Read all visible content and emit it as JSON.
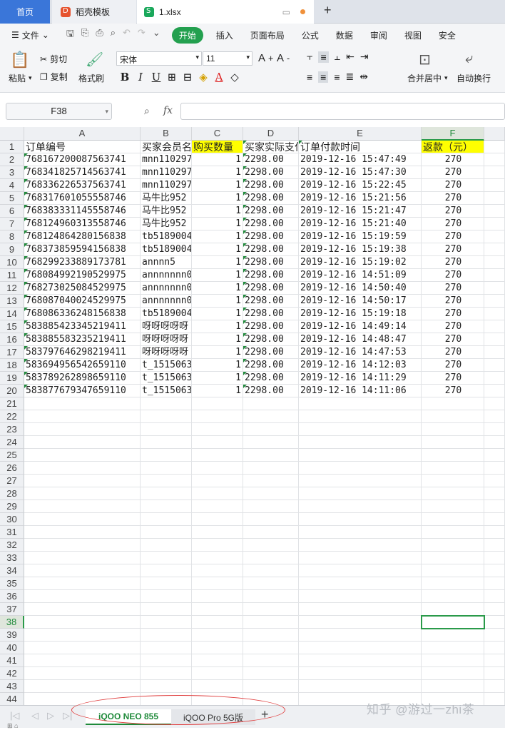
{
  "tabs": {
    "home": "首页",
    "template": "稻壳模板",
    "file": "1.xlsx"
  },
  "menu": {
    "file": "文件",
    "items": [
      "开始",
      "插入",
      "页面布局",
      "公式",
      "数据",
      "审阅",
      "视图",
      "安全"
    ]
  },
  "ribbon": {
    "paste": "粘贴",
    "cut": "剪切",
    "copy": "复制",
    "format_painter": "格式刷",
    "font_name": "宋体",
    "font_size": "11",
    "merge": "合并居中",
    "wrap": "自动换行"
  },
  "formula_bar": {
    "cell_ref": "F38",
    "fx": "fx",
    "content": ""
  },
  "columns": [
    "A",
    "B",
    "C",
    "D",
    "E",
    "F"
  ],
  "header_row": [
    "订单编号",
    "买家会员名",
    "购买数量",
    "买家实际支付",
    "订单付款时间",
    "返款（元）"
  ],
  "rows": [
    [
      "768167200087563741",
      "mnn110297",
      "1",
      "2298.00",
      "2019-12-16 15:47:49",
      "270"
    ],
    [
      "768341825714563741",
      "mnn110297",
      "1",
      "2298.00",
      "2019-12-16 15:47:30",
      "270"
    ],
    [
      "768336226537563741",
      "mnn110297",
      "1",
      "2298.00",
      "2019-12-16 15:22:45",
      "270"
    ],
    [
      "768317601055558746",
      "马牛比952",
      "1",
      "2298.00",
      "2019-12-16 15:21:56",
      "270"
    ],
    [
      "768383331145558746",
      "马牛比952",
      "1",
      "2298.00",
      "2019-12-16 15:21:47",
      "270"
    ],
    [
      "768124960313558746",
      "马牛比952",
      "1",
      "2298.00",
      "2019-12-16 15:21:40",
      "270"
    ],
    [
      "768124864280156838",
      "tb5189004",
      "1",
      "2298.00",
      "2019-12-16 15:19:59",
      "270"
    ],
    [
      "768373859594156838",
      "tb5189004",
      "1",
      "2298.00",
      "2019-12-16 15:19:38",
      "270"
    ],
    [
      "768299233889173781",
      "annnn5",
      "1",
      "2298.00",
      "2019-12-16 15:19:02",
      "270"
    ],
    [
      "768084992190529975",
      "annnnnnn0",
      "1",
      "2298.00",
      "2019-12-16 14:51:09",
      "270"
    ],
    [
      "768273025084529975",
      "annnnnnn0",
      "1",
      "2298.00",
      "2019-12-16 14:50:40",
      "270"
    ],
    [
      "768087040024529975",
      "annnnnnn0",
      "1",
      "2298.00",
      "2019-12-16 14:50:17",
      "270"
    ],
    [
      "768086336248156838",
      "tb5189004",
      "1",
      "2298.00",
      "2019-12-16 15:19:18",
      "270"
    ],
    [
      "583885423345219411",
      "呀呀呀呀呀",
      "1",
      "2298.00",
      "2019-12-16 14:49:14",
      "270"
    ],
    [
      "583885583235219411",
      "呀呀呀呀呀",
      "1",
      "2298.00",
      "2019-12-16 14:48:47",
      "270"
    ],
    [
      "583797646298219411",
      "呀呀呀呀呀",
      "1",
      "2298.00",
      "2019-12-16 14:47:53",
      "270"
    ],
    [
      "583694956542659110",
      "t_1515063",
      "1",
      "2298.00",
      "2019-12-16 14:12:03",
      "270"
    ],
    [
      "583789262898659110",
      "t_1515063",
      "1",
      "2298.00",
      "2019-12-16 14:11:29",
      "270"
    ],
    [
      "583877679347659110",
      "t_1515063",
      "1",
      "2298.00",
      "2019-12-16 14:11:06",
      "270"
    ]
  ],
  "total_rows": 44,
  "selected": {
    "row": 38,
    "col": "F"
  },
  "sheets": [
    "iQOO NEO 855",
    "iQOO Pro 5G版"
  ],
  "active_sheet": 0,
  "watermark": "知乎 @游过一zhi茶",
  "colors": {
    "accent_green": "#1f8a3a",
    "highlight_yellow": "#ffff00",
    "annotation_red": "#e04040"
  }
}
